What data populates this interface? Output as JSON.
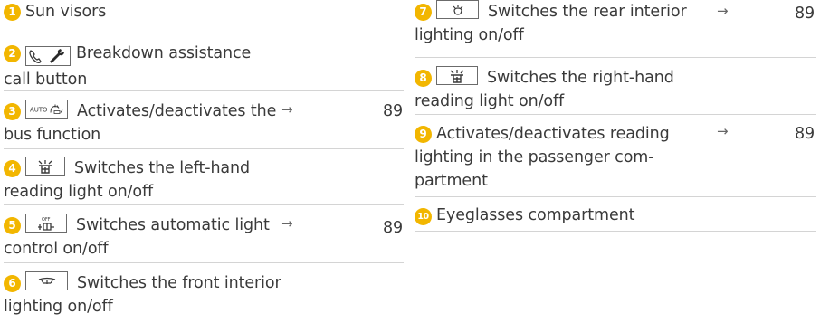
{
  "left": [
    {
      "num": "1",
      "icon": "",
      "text": "Sun visors",
      "page": ""
    },
    {
      "num": "2",
      "icon": "breakdown-assistance-icon",
      "text": "Breakdown assistance call button",
      "page": ""
    },
    {
      "num": "3",
      "icon": "auto-bus-function-icon",
      "text": "Activates/deactivates the bus function",
      "page": "89"
    },
    {
      "num": "4",
      "icon": "reading-light-icon",
      "text": "Switches the left-hand reading light on/off",
      "page": ""
    },
    {
      "num": "5",
      "icon": "auto-light-off-icon",
      "text": "Switches automatic light control on/off",
      "page": "89"
    },
    {
      "num": "6",
      "icon": "front-interior-light-icon",
      "text": "Switches the front interior lighting on/off",
      "page": ""
    }
  ],
  "right": [
    {
      "num": "7",
      "icon": "rear-interior-light-icon",
      "text": "Switches the rear interior lighting on/off",
      "page": "89"
    },
    {
      "num": "8",
      "icon": "reading-light-icon",
      "text": "Switches the right-hand reading light on/off",
      "page": ""
    },
    {
      "num": "9",
      "icon": "",
      "text": "Activates/deactivates reading lighting in the passenger com-partment",
      "page": "89"
    },
    {
      "num": "10",
      "icon": "",
      "text": "Eyeglasses compartment",
      "page": ""
    }
  ],
  "labels": {
    "i1_text": "Sun visors",
    "i2_l1": "Breakdown assistance",
    "i2_l2": "call button",
    "i3_l1": "Activates/deactivates the",
    "i3_l2": "bus function",
    "i4_l1": "Switches the left-hand",
    "i4_l2": "reading light on/off",
    "i5_l1": "Switches automatic light",
    "i5_l2": "control on/off",
    "i6_l1": "Switches the front interior",
    "i6_l2": "lighting on/off",
    "i7_l1": "Switches the rear interior",
    "i7_l2": "lighting on/off",
    "i8_l1": "Switches the right-hand",
    "i8_l2": "reading light on/off",
    "i9_l1": "Activates/deactivates reading",
    "i9_l2": "lighting in the passenger com-",
    "i9_l3": "partment",
    "i10_text": "Eyeglasses compartment",
    "arrow": "→",
    "auto_text": "AUTO",
    "off_text": "OFF"
  },
  "colors": {
    "badge": "#f2b600",
    "text": "#3a3a3a",
    "rule": "#d4d4d4"
  }
}
